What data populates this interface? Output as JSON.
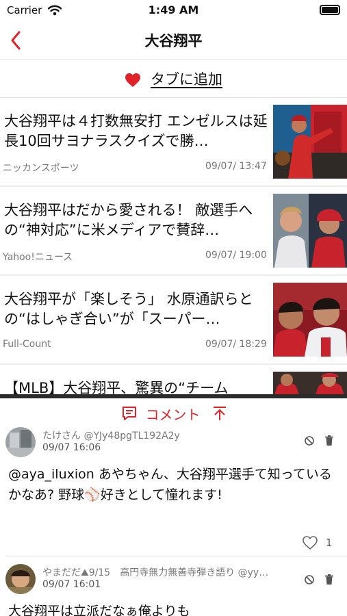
{
  "status_bar": {
    "carrier": "Carrier",
    "time": "1:49 AM"
  },
  "nav": {
    "title": "大谷翔平"
  },
  "add_tab": {
    "label": "タブに追加"
  },
  "articles": [
    {
      "title": "大谷翔平は４打数無安打 エンゼルスは延長10回サヨナラスクイズで勝…",
      "source": "ニッカンスポーツ",
      "time": "09/07/ 13:47"
    },
    {
      "title": "大谷翔平はだから愛される！ 敵選手への“神対応”に米メディアで賛辞…",
      "source": "Yahoo!ニュース",
      "time": "09/07/ 19:00"
    },
    {
      "title": "大谷翔平が「楽しそう」 水原通訳らとの“はしゃぎ合い”が「スーパー…",
      "source": "Full-Count",
      "time": "09/07/ 18:29"
    },
    {
      "title": "【MLB】大谷翔平、驚異の“チーム",
      "source": "",
      "time": ""
    }
  ],
  "comments_panel": {
    "label": "コメント",
    "comments": [
      {
        "user": "たけさん @YJy48pgTL192A2y",
        "date": "09/07 16:06",
        "body": "@aya_iluxion あやちゃん、大谷翔平選手て知っているかなあ? 野球⚾好きとして憧れます!",
        "likes": "1"
      },
      {
        "user": "やまだだ⛰9/15　高円寺無力無善寺弾き語り @yy…",
        "date": "09/07 16:01",
        "body": "大谷翔平は立派だなぁ俺よりも"
      }
    ]
  },
  "colors": {
    "accent": "#e0232b",
    "text": "#111111",
    "secondary": "#777777"
  }
}
